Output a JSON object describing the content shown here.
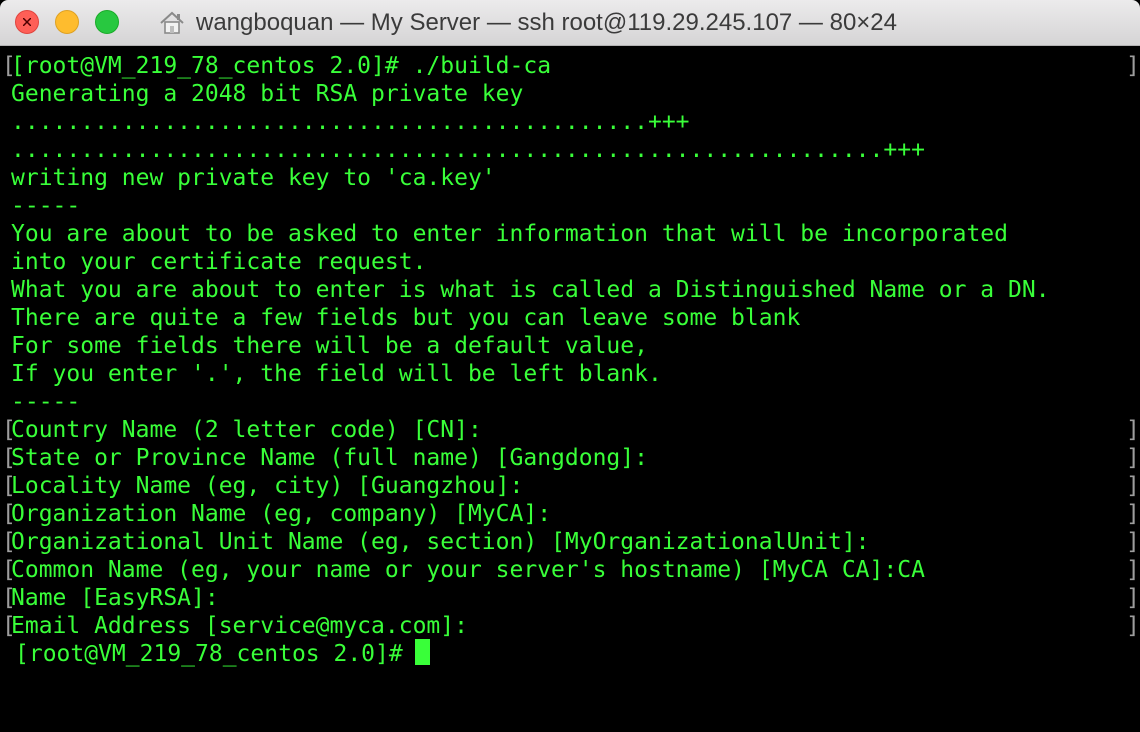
{
  "window": {
    "title": "wangboquan — My Server — ssh root@119.29.245.107 — 80×24"
  },
  "terminal": {
    "lines": [
      "[root@VM_219_78_centos 2.0]# ./build-ca",
      "Generating a 2048 bit RSA private key",
      "..............................................+++",
      "...............................................................+++",
      "writing new private key to 'ca.key'",
      "-----",
      "You are about to be asked to enter information that will be incorporated",
      "into your certificate request.",
      "What you are about to enter is what is called a Distinguished Name or a DN.",
      "There are quite a few fields but you can leave some blank",
      "For some fields there will be a default value,",
      "If you enter '.', the field will be left blank.",
      "-----",
      "Country Name (2 letter code) [CN]:",
      "State or Province Name (full name) [Gangdong]:",
      "Locality Name (eg, city) [Guangzhou]:",
      "Organization Name (eg, company) [MyCA]:",
      "Organizational Unit Name (eg, section) [MyOrganizationalUnit]:",
      "Common Name (eg, your name or your server's hostname) [MyCA CA]:CA",
      "Name [EasyRSA]:",
      "Email Address [service@myca.com]:",
      "[root@VM_219_78_centos 2.0]# "
    ]
  }
}
